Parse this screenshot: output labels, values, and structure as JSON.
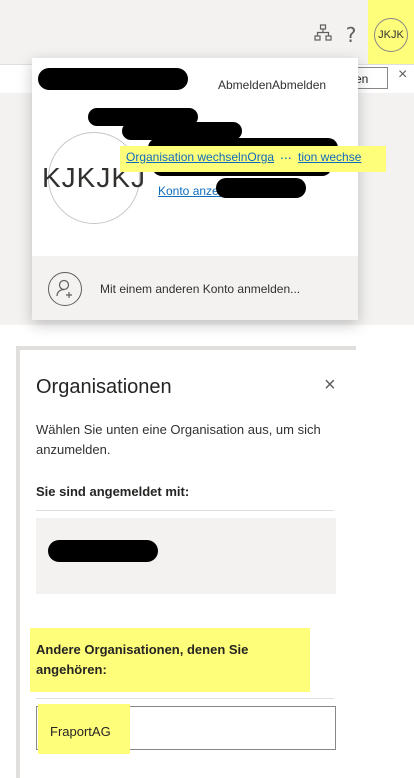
{
  "flyout": {
    "signout_label": "AbmeldenAbmelden",
    "avatar_initials": "KJKJKJ",
    "top_avatar_initials": "JKJK",
    "konto_link": "Konto anzeigen",
    "org_switch_link": "Organisation wechselnOrga",
    "org_switch_ellipsis": "...",
    "org_switch_tail": "tion wechse",
    "other_account": "Mit einem anderen Konto anmelden...",
    "help_glyph": "?"
  },
  "background": {
    "button_partial": "en",
    "close_glyph": "×"
  },
  "dialog": {
    "title": "Organisationen",
    "close_glyph": "×",
    "description": "Wählen Sie unten eine Organisation aus, um sich anzumelden.",
    "signed_in_label": "Sie sind angemeldet mit:",
    "other_orgs_label": "Andere Organisationen, denen Sie angehören:",
    "org_option": "FraportAG"
  },
  "colors": {
    "highlight": "#fffe7a",
    "link": "#0f6cbd",
    "redaction": "#000000"
  },
  "icons": {
    "org": "org-chart-icon",
    "help": "help-icon",
    "add_person": "person-add-icon",
    "close": "close-icon"
  }
}
